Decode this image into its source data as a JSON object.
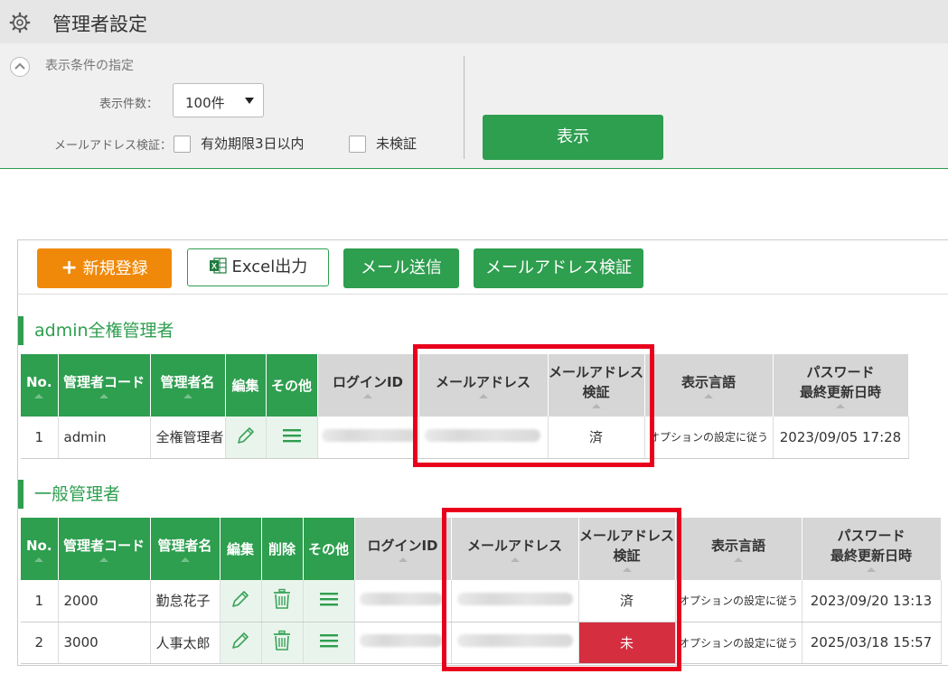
{
  "header": {
    "title": "管理者設定",
    "icon": "gear-icon"
  },
  "conditions": {
    "title": "表示条件の指定",
    "count_label": "表示件数：",
    "count_value": "100件",
    "mail_label": "メールアドレス検証：",
    "checkbox1": "有効期限3日以内",
    "checkbox2": "未検証",
    "show_button": "表示"
  },
  "toolbar": {
    "new_button": "新規登録",
    "excel_button": "Excel出力",
    "mail_button": "メール送信",
    "verify_button": "メールアドレス検証"
  },
  "colors": {
    "accent": "#2e9e4f",
    "orange": "#f0890a",
    "alert": "#d42e3f",
    "highlight": "#e8001c"
  },
  "section1": {
    "title": "admin全権管理者",
    "headers": {
      "no": "No.",
      "code": "管理者コード",
      "name": "管理者名",
      "edit": "編集",
      "other": "その他",
      "login": "ログインID",
      "mail": "メールアドレス",
      "verify1": "メールアドレス",
      "verify2": "検証",
      "lang": "表示言語",
      "pw1": "パスワード",
      "pw2": "最終更新日時"
    },
    "rows": [
      {
        "no": "1",
        "code": "admin",
        "name": "全権管理者",
        "verified": "済",
        "lang": "オプションの設定に従う",
        "updated": "2023/09/05 17:28"
      }
    ]
  },
  "section2": {
    "title": "一般管理者",
    "headers": {
      "no": "No.",
      "code": "管理者コード",
      "name": "管理者名",
      "edit": "編集",
      "delete": "削除",
      "other": "その他",
      "login": "ログインID",
      "mail": "メールアドレス",
      "verify1": "メールアドレス",
      "verify2": "検証",
      "lang": "表示言語",
      "pw1": "パスワード",
      "pw2": "最終更新日時"
    },
    "rows": [
      {
        "no": "1",
        "code": "2000",
        "name": "勤怠花子",
        "verified": "済",
        "lang": "オプションの設定に従う",
        "updated": "2023/09/20 13:13"
      },
      {
        "no": "2",
        "code": "3000",
        "name": "人事太郎",
        "verified": "未",
        "lang": "オプションの設定に従う",
        "updated": "2025/03/18 15:57"
      }
    ]
  }
}
